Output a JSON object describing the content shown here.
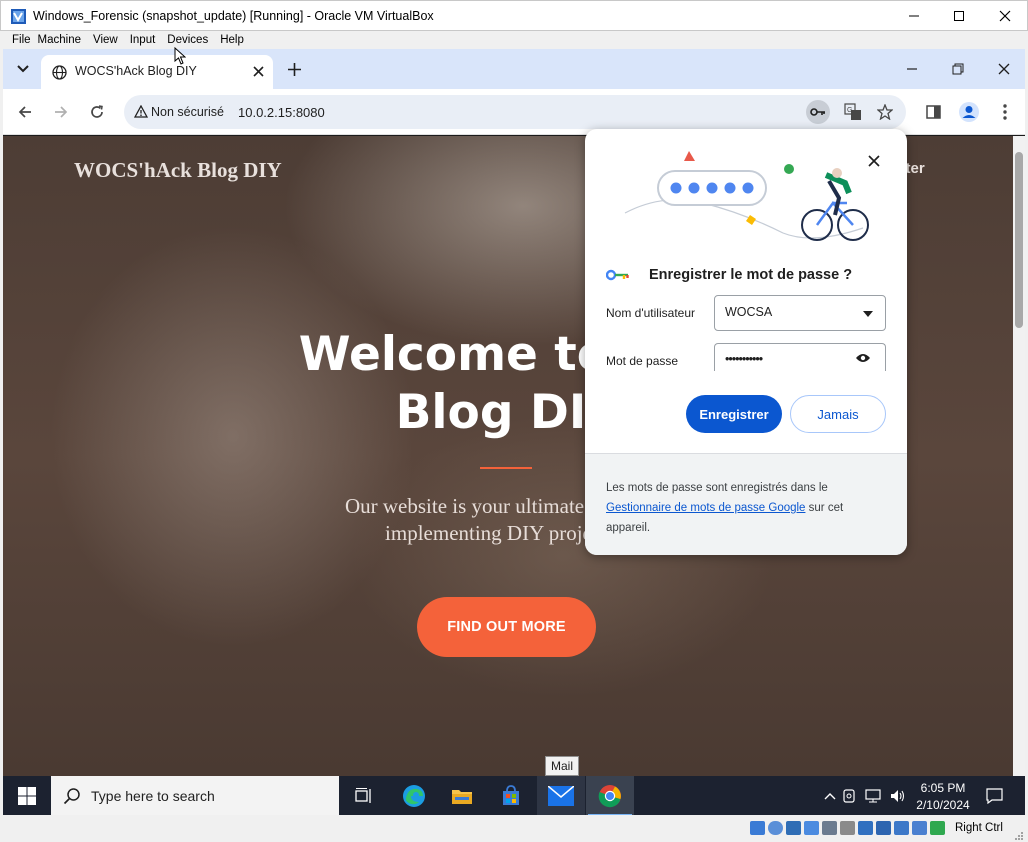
{
  "vbox": {
    "title": "Windows_Forensic (snapshot_update) [Running] - Oracle VM VirtualBox",
    "menu": [
      "File",
      "Machine",
      "View",
      "Input",
      "Devices",
      "Help"
    ],
    "host_key": "Right Ctrl"
  },
  "browser": {
    "tab_title": "WOCS'hAck Blog DIY",
    "security_label": "Non sécurisé",
    "url": "10.0.2.15:8080"
  },
  "page": {
    "brand": "WOCS'hAck Blog DIY",
    "nav_partial": "ister",
    "hero_line1": "Welcome to WO",
    "hero_line2": "Blog DIY",
    "subtitle_line1": "Our website is your ultimate destinatio",
    "subtitle_line2": "implementing DIY projects h",
    "cta": "FIND OUT MORE",
    "accent": "#f4623a"
  },
  "password_popup": {
    "title": "Enregistrer le mot de passe ?",
    "username_label": "Nom d'utilisateur",
    "username_value": "WOCSA",
    "password_label": "Mot de passe",
    "password_value": "•••••••••••",
    "save_button": "Enregistrer",
    "never_button": "Jamais",
    "footer_before": "Les mots de passe sont enregistrés dans le ",
    "footer_link": "Gestionnaire de mots de passe Google",
    "footer_after": " sur cet appareil."
  },
  "taskbar": {
    "search_placeholder": "Type here to search",
    "time": "6:05 PM",
    "date": "2/10/2024",
    "tooltip": "Mail"
  }
}
